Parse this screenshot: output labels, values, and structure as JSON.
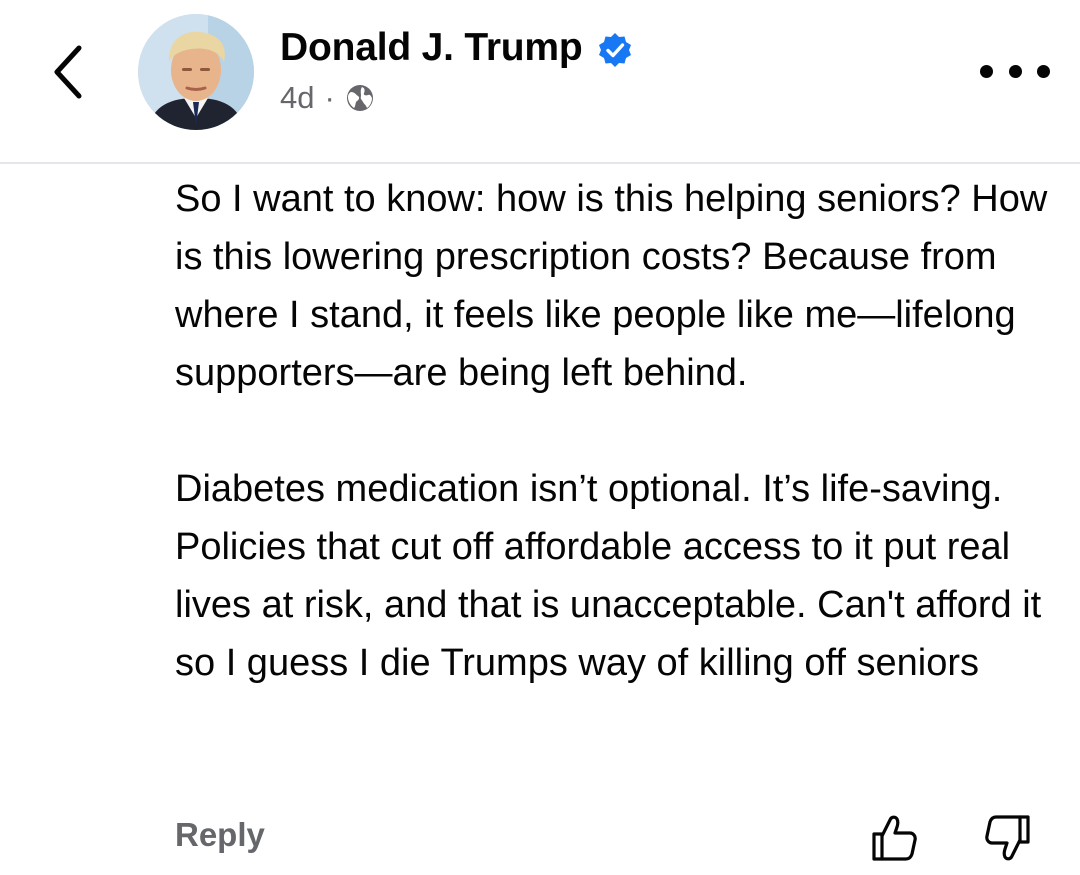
{
  "post_header": {
    "author_name": "Donald J. Trump",
    "verified": true,
    "timestamp": "4d",
    "separator": "·",
    "audience_icon": "globe-icon",
    "back_icon": "chevron-left-icon",
    "more_icon": "more-horizontal-icon"
  },
  "comment": {
    "paragraphs": [
      "So I want to know: how is this helping seniors? How is this lowering prescription costs? Because from where I stand, it feels like people like me—lifelong supporters—are being left behind.",
      "Diabetes medication isn’t optional. It’s life-saving. Policies that cut off affordable access to it put real lives at risk, and that is unacceptable.  Can't afford it so I guess I die Trumps way of killing off seniors"
    ]
  },
  "actions": {
    "reply_label": "Reply",
    "like_icon": "thumbs-up-icon",
    "dislike_icon": "thumbs-down-icon"
  },
  "colors": {
    "text_primary": "#050505",
    "text_secondary": "#65676b",
    "verified_blue": "#1877f2",
    "divider": "#e4e6eb"
  }
}
